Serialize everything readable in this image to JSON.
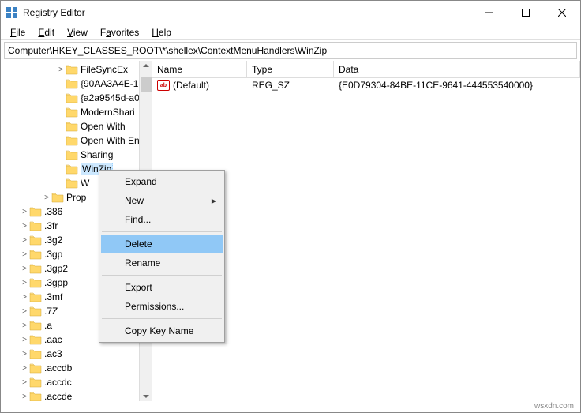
{
  "window": {
    "title": "Registry Editor"
  },
  "menubar": {
    "file": "File",
    "edit": "Edit",
    "view": "View",
    "favorites": "Favorites",
    "help": "Help"
  },
  "addressbar": {
    "path": "Computer\\HKEY_CLASSES_ROOT\\*\\shellex\\ContextMenuHandlers\\WinZip"
  },
  "tree": {
    "shellex_items": [
      {
        "label": "FileSyncEx",
        "expander": ">"
      },
      {
        "label": "{90AA3A4E-1",
        "expander": ""
      },
      {
        "label": "{a2a9545d-a0",
        "expander": ""
      },
      {
        "label": "ModernShari",
        "expander": ""
      },
      {
        "label": "Open With",
        "expander": ""
      },
      {
        "label": "Open With En",
        "expander": ""
      },
      {
        "label": "Sharing",
        "expander": ""
      },
      {
        "label": "WinZip",
        "expander": "",
        "selected": true
      },
      {
        "label": "W",
        "expander": ""
      }
    ],
    "prop_label": "Prop",
    "ext_items": [
      ".386",
      ".3fr",
      ".3g2",
      ".3gp",
      ".3gp2",
      ".3gpp",
      ".3mf",
      ".7Z",
      ".a",
      ".aac",
      ".ac3",
      ".accdb",
      ".accdc",
      ".accde"
    ]
  },
  "list": {
    "headers": {
      "name": "Name",
      "type": "Type",
      "data": "Data"
    },
    "col_widths": {
      "name": 120,
      "type": 110,
      "data": 300
    },
    "rows": [
      {
        "name": "(Default)",
        "type": "REG_SZ",
        "data": "{E0D79304-84BE-11CE-9641-444553540000}"
      }
    ]
  },
  "context_menu": {
    "expand": "Expand",
    "new": "New",
    "find": "Find...",
    "delete": "Delete",
    "rename": "Rename",
    "export": "Export",
    "permissions": "Permissions...",
    "copy_key_name": "Copy Key Name"
  },
  "footer": "wsxdn.com"
}
